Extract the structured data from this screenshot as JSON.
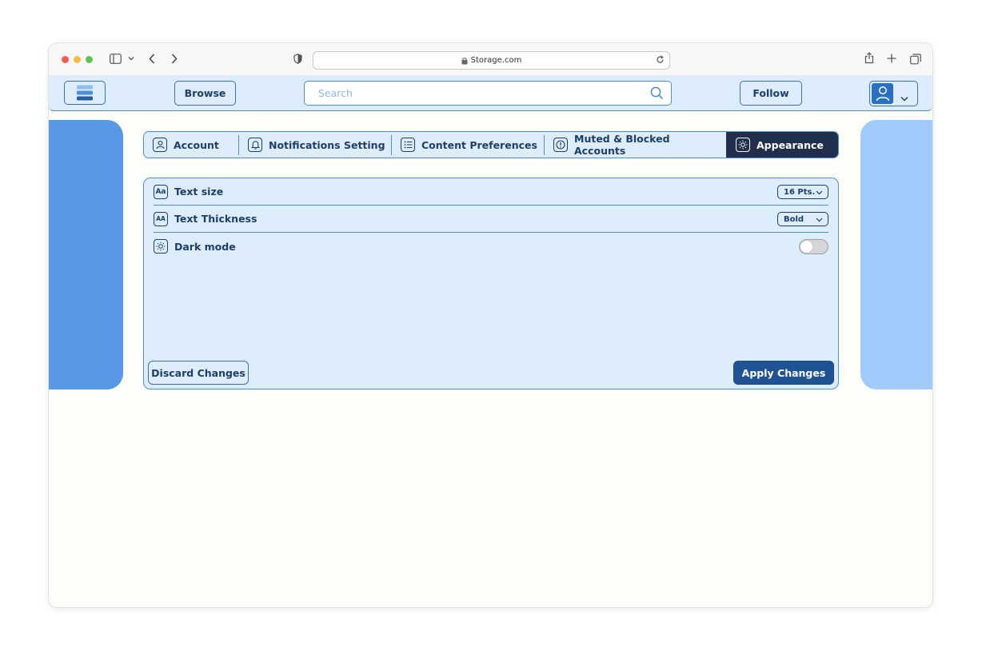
{
  "browser": {
    "url": "Storage.com",
    "icons": [
      "sidebar-icon",
      "chevron-down-icon",
      "back-icon",
      "forward-icon",
      "shield-icon",
      "lock-icon",
      "reload-icon",
      "share-icon",
      "new-tab-icon",
      "tabs-overview-icon"
    ]
  },
  "header": {
    "browse_label": "Browse",
    "search_placeholder": "Search",
    "follow_label": "Follow",
    "icons": [
      "menu-icon",
      "search-icon",
      "user-icon",
      "chevron-down-icon"
    ]
  },
  "tabs": [
    {
      "label": "Account",
      "icon": "user-icon",
      "active": false
    },
    {
      "label": "Notifications Setting",
      "icon": "bell-icon",
      "active": false
    },
    {
      "label": "Content Preferences",
      "icon": "list-icon",
      "active": false
    },
    {
      "label": "Muted & Blocked Accounts",
      "icon": "alert-icon",
      "active": false
    },
    {
      "label": "Appearance",
      "icon": "sun-icon",
      "active": true
    }
  ],
  "settings": {
    "text_size": {
      "label": "Text size",
      "icon_glyph": "Aa",
      "value": "16 Pts."
    },
    "text_thickness": {
      "label": "Text Thickness",
      "icon_glyph": "AA",
      "value": "Bold"
    },
    "dark_mode": {
      "label": "Dark mode",
      "icon": "sun-icon",
      "enabled": false
    }
  },
  "actions": {
    "discard_label": "Discard Changes",
    "apply_label": "Apply Changes"
  },
  "colors": {
    "accent": "#1f5394",
    "active_tab": "#1f2f4d",
    "panel_bg": "#deedfd",
    "border": "#4a90cf",
    "side_left": "#5899e5",
    "side_right": "#a0cbfc"
  }
}
